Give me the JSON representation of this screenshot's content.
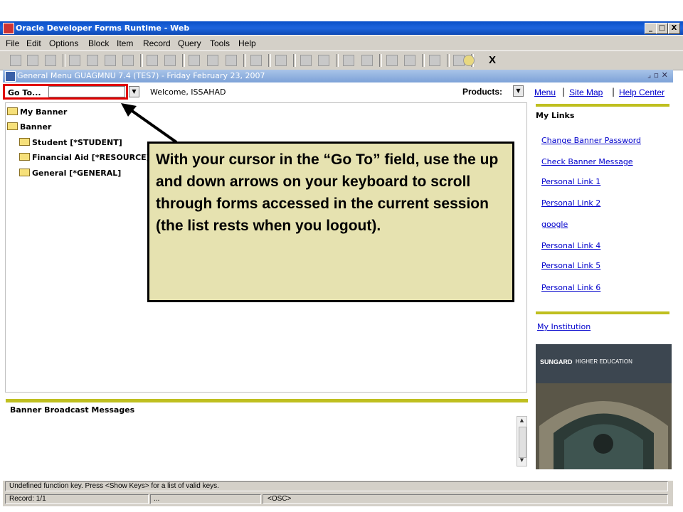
{
  "window": {
    "title": "Oracle Developer Forms Runtime - Web",
    "min": "_",
    "max": "□",
    "close": "X"
  },
  "menubar": [
    "File",
    "Edit",
    "Options",
    "Block",
    "Item",
    "Record",
    "Query",
    "Tools",
    "Help"
  ],
  "toolbar": {
    "exit_label": "X"
  },
  "form": {
    "title": "General Menu  GUAGMNU  7.4  (TES7) - Friday February 23, 2007"
  },
  "goto": {
    "label": "Go To...",
    "value": ""
  },
  "welcome": "Welcome, ISSAHAD",
  "products": {
    "label": "Products:"
  },
  "top_links": {
    "menu": "Menu",
    "site_map": "Site Map",
    "help_center": "Help Center",
    "separator": "|"
  },
  "tree": [
    {
      "label": "My Banner"
    },
    {
      "label": "Banner"
    },
    {
      "label": "Student [*STUDENT]"
    },
    {
      "label": "Financial Aid [*RESOURCE]"
    },
    {
      "label": "General [*GENERAL]"
    }
  ],
  "callout": "With your cursor in the “Go To” field, use the up and down arrows on your keyboard to scroll through forms accessed in the current session (the list rests when you logout).",
  "my_links": {
    "title": "My Links",
    "items": [
      "Change Banner Password",
      "Check Banner Message",
      "Personal Link 1",
      "Personal Link 2",
      "google",
      "Personal Link 4",
      "Personal Link 5",
      "Personal Link 6"
    ]
  },
  "my_institution": "My Institution",
  "sungard": {
    "brand": "SUNGARD",
    "tagline": "HIGHER EDUCATION"
  },
  "broadcast": {
    "title": "Banner Broadcast Messages"
  },
  "status": {
    "message": "Undefined function key. Press <Show Keys> for a list of valid keys.",
    "record": "Record: 1/1",
    "mid": "...",
    "osc": "<OSC>"
  },
  "colors": {
    "accent_bar": "#bfbf1f",
    "callout_bg": "#e6e2b0",
    "highlight": "#e00000"
  }
}
